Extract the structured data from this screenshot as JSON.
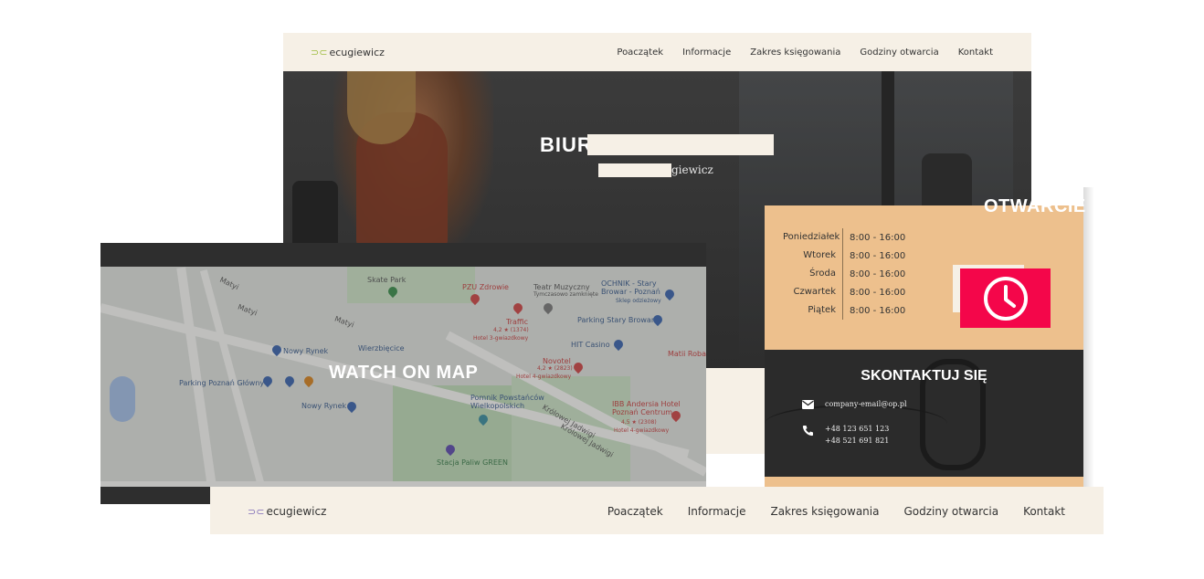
{
  "top_header": {
    "logo_mark": "⊃⊂",
    "logo_text": "ecugiewicz",
    "nav": [
      "Poaczątek",
      "Informacje",
      "Zakres księgowania",
      "Godziny otwarcia",
      "Kontakt"
    ]
  },
  "hero": {
    "title": "BIUR",
    "subtitle": "giewicz"
  },
  "map": {
    "cta": "WATCH ON MAP",
    "labels": [
      "Skate Park",
      "PZU Zdrowie",
      "Teatr Muzyczny",
      "Tymczasowo zamknięte",
      "OCHNIK - Stary Browar - Poznań",
      "Sklep odzieżowy",
      "Traffic",
      "4,2 ★ (1374)",
      "Hotel 3-gwiazdkowy",
      "Parking Stary Browar",
      "Nowy Rynek",
      "Wierzbięcice",
      "HIT Casino",
      "Novotel",
      "4,2 ★ (2823)",
      "Hotel 4-gwiazdkowy",
      "Matii Roba",
      "Parking Poznań Główny",
      "Pomnik Powstańców Wielkopolskich",
      "IBB Andersia Hotel Poznań Centrum",
      "4,5 ★ (2308)",
      "Hotel 4-gwiazdkowy",
      "Nowy Rynek",
      "Stacja Paliw GREEN",
      "Matyi",
      "Matyi",
      "Matyi",
      "Królowej Jadwigi",
      "Królowej Jadwigi"
    ]
  },
  "hours": {
    "title": "OTWARCIE",
    "rows": [
      {
        "day": "Poniedziałek",
        "time": "8:00 - 16:00"
      },
      {
        "day": "Wtorek",
        "time": "8:00 - 16:00"
      },
      {
        "day": "Środa",
        "time": "8:00 - 16:00"
      },
      {
        "day": "Czwartek",
        "time": "8:00 - 16:00"
      },
      {
        "day": "Piątek",
        "time": "8:00 - 16:00"
      }
    ],
    "accent_color": "#f4064a",
    "card_color": "#edc08d"
  },
  "contact": {
    "title": "SKONTAKTUJ SIĘ",
    "email": "company-email@op.pl",
    "phone1": "+48 123 651 123",
    "phone2": "+48 521 691 821"
  },
  "bottom_header": {
    "logo_mark": "⊃⊂",
    "logo_text": "ecugiewicz",
    "nav": [
      "Poaczątek",
      "Informacje",
      "Zakres księgowania",
      "Godziny otwarcia",
      "Kontakt"
    ]
  }
}
